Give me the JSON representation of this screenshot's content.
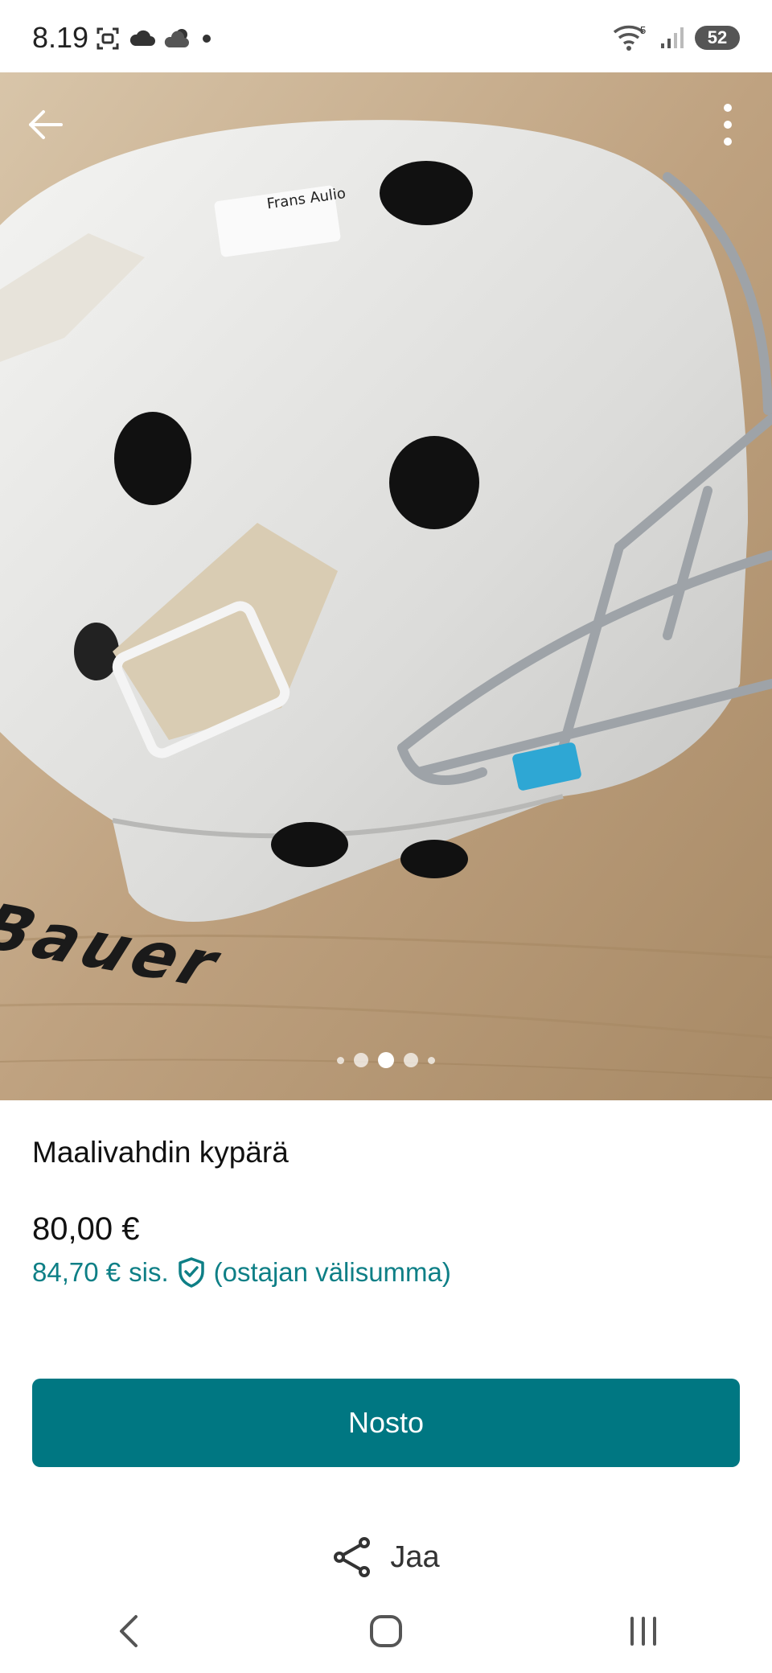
{
  "status_bar": {
    "time": "8.19",
    "battery": "52",
    "icons_left": [
      "screenshot-icon",
      "cloud-icon",
      "weather-icon",
      "dot-icon"
    ],
    "icons_right": [
      "wifi-icon",
      "signal-icon",
      "battery-icon"
    ],
    "wifi_badge": "5"
  },
  "gallery": {
    "photo_sticker_text": "Frans Aulio",
    "photo_brand_text": "Bauer",
    "page_count": 5,
    "active_index": 2
  },
  "item": {
    "title": "Maalivahdin kypärä",
    "price": "80,00 €",
    "price_incl": "84,70 €",
    "price_incl_word": "sis.",
    "price_incl_note": "(ostajan välisumma)"
  },
  "actions": {
    "primary_label": "Nosto",
    "share_label": "Jaa"
  },
  "colors": {
    "accent": "#007782",
    "accent_text": "#0e7f86"
  }
}
